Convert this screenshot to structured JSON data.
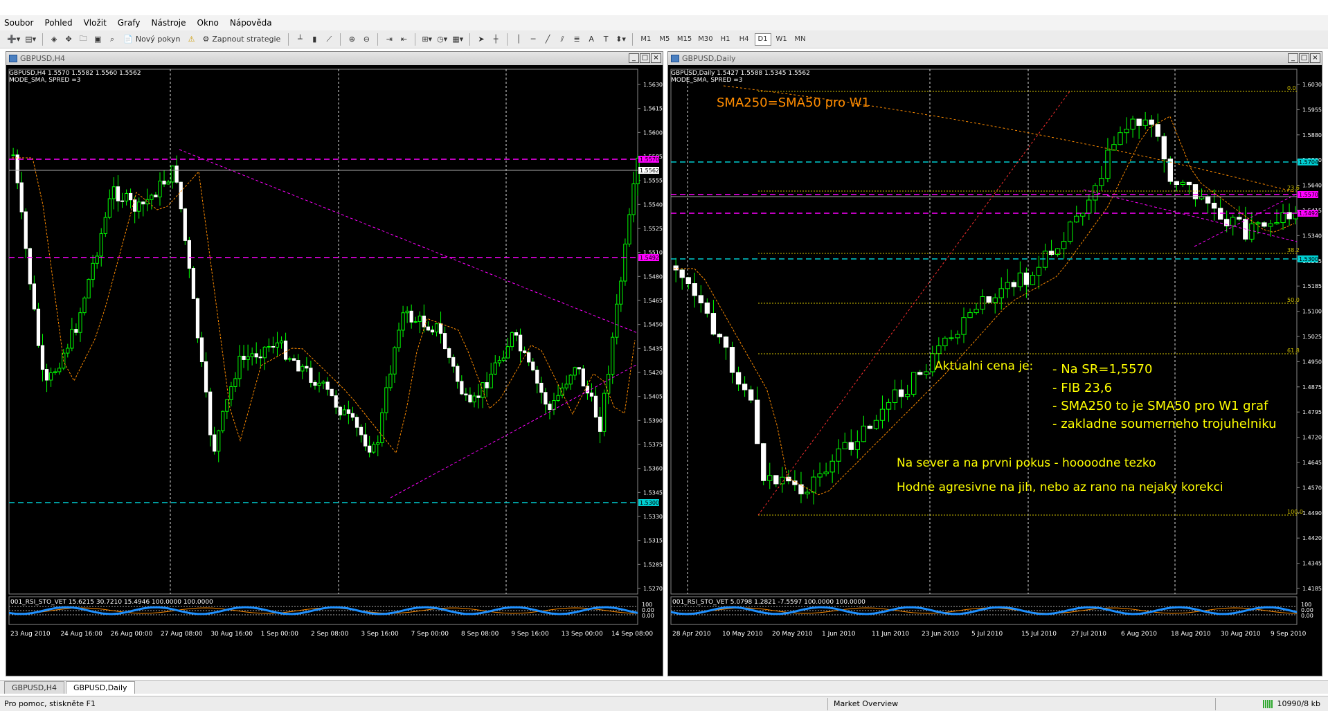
{
  "menu": [
    "Soubor",
    "Pohled",
    "Vložit",
    "Grafy",
    "Nástroje",
    "Okno",
    "Nápověda"
  ],
  "toolbar": {
    "new_order": "Nový pokyn",
    "start_strategy": "Zapnout strategie",
    "timeframes": [
      "M1",
      "M5",
      "M15",
      "M30",
      "H1",
      "H4",
      "D1",
      "W1",
      "MN"
    ],
    "active_tf": "D1"
  },
  "left_chart": {
    "window_title": "GBPUSD,H4",
    "info_line1": "GBPUSD,H4  1.5570 1.5582 1.5560 1.5562",
    "info_line2": "MODE_SMA, SPRED =3",
    "price_labels": [
      "1.5630",
      "1.5615",
      "1.5600",
      "1.5585",
      "1.5555",
      "1.5540",
      "1.5525",
      "1.5510",
      "1.5480",
      "1.5465",
      "1.5450",
      "1.5435",
      "1.5420",
      "1.5405",
      "1.5390",
      "1.5375",
      "1.5360",
      "1.5345",
      "1.5330",
      "1.5315",
      "1.5285",
      "1.5270"
    ],
    "lvl_high": "1.5570",
    "lvl_cur": "1.5562",
    "lvl_mid": "1.5492",
    "lvl_low": "1.5300",
    "indicator": "001_RSI_STO_VET 15.6215 30.7210 15.4946 100.0000 100.0000",
    "ind_axis": [
      "100",
      "0.00",
      "0.00"
    ],
    "time_labels": [
      "23 Aug 2010",
      "24 Aug 16:00",
      "26 Aug 00:00",
      "27 Aug 08:00",
      "30 Aug 16:00",
      "1 Sep 00:00",
      "2 Sep 08:00",
      "3 Sep 16:00",
      "7 Sep 00:00",
      "8 Sep 08:00",
      "9 Sep 16:00",
      "13 Sep 00:00",
      "14 Sep 08:00"
    ]
  },
  "right_chart": {
    "window_title": "GBPUSD,Daily",
    "info_line1": "GBPUSD,Daily  1.5427 1.5588 1.5345 1.5562",
    "info_line2": "MODE_SMA, SPRED =3",
    "price_labels": [
      "1.6030",
      "1.5955",
      "1.5880",
      "1.5800",
      "1.5640",
      "1.5415",
      "1.5340",
      "1.5265",
      "1.5185",
      "1.5100",
      "1.5025",
      "1.4950",
      "1.4875",
      "1.4795",
      "1.4720",
      "1.4645",
      "1.4570",
      "1.4490",
      "1.4420",
      "1.4345",
      "1.4185"
    ],
    "lvl_1704": "1.5704",
    "lvl_1570": "1.5570",
    "lvl_1492": "1.5492",
    "lvl_1300": "1.5300",
    "fib": [
      "0.0",
      "23.6",
      "38.2",
      "50.0",
      "61.8",
      "100.0"
    ],
    "indicator": "001_RSI_STO_VET 5.0798 1.2821 -7.5597 100.0000 100.0000",
    "ind_axis": [
      "100",
      "0.00",
      "0.00"
    ],
    "time_labels": [
      "28 Apr 2010",
      "10 May 2010",
      "20 May 2010",
      "1 Jun 2010",
      "11 Jun 2010",
      "23 Jun 2010",
      "5 Jul 2010",
      "15 Jul 2010",
      "27 Jul 2010",
      "6 Aug 2010",
      "18 Aug 2010",
      "30 Aug 2010",
      "9 Sep 2010"
    ],
    "annotations": {
      "sma": "SMA250=SMA50 pro W1",
      "current": "Aktualni cena je:",
      "b1": "- Na SR=1,5570",
      "b2": "- FIB 23,6",
      "b3": "- SMA250 to je SMA50 pro W1 graf",
      "b4": "- zakladne soumerneho trojuhelniku",
      "north": "Na sever a na prvni pokus - hoooodne tezko",
      "south": "Hodne agresivne na jih, nebo az rano na nejaky korekci"
    }
  },
  "tabs": [
    "GBPUSD,H4",
    "GBPUSD,Daily"
  ],
  "active_tab": "GBPUSD,Daily",
  "status": {
    "help": "Pro pomoc, stiskněte F1",
    "profile": "Market Overview",
    "traffic": "10990/8 kb"
  }
}
